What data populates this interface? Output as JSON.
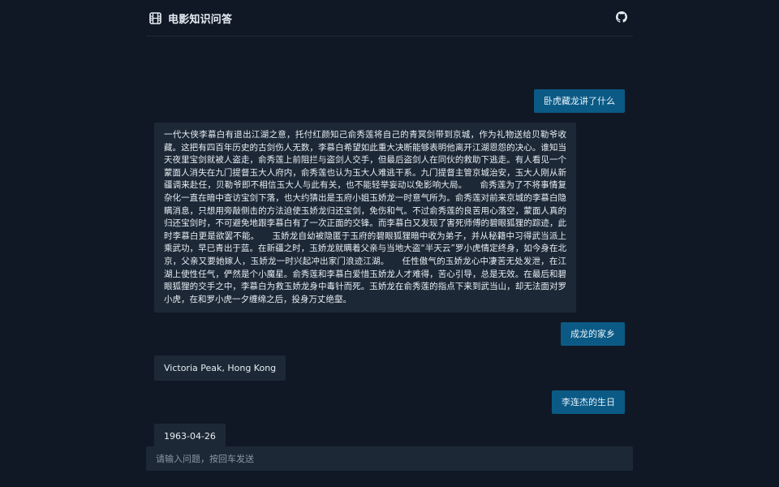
{
  "header": {
    "title": "电影知识问答",
    "logo_icon": "film-icon",
    "github_icon": "github-icon"
  },
  "colors": {
    "background": "#101826",
    "user_bubble": "#0b5a85",
    "bot_bubble": "#1d2836"
  },
  "messages": [
    {
      "role": "user",
      "text": "卧虎藏龙讲了什么"
    },
    {
      "role": "bot",
      "text": "一代大侠李慕白有退出江湖之意，托付红颜知己俞秀莲将自己的青冥剑带到京城，作为礼物送给贝勒爷收藏。这把有四百年历史的古剑伤人无数，李慕白希望如此重大决断能够表明他离开江湖恩怨的决心。谁知当天夜里宝剑就被人盗走，俞秀莲上前阻拦与盗剑人交手，但最后盗剑人在同伙的救助下逃走。有人看见一个蒙面人消失在九门提督玉大人府内，俞秀莲也认为玉大人难逃干系。九门提督主管京城治安，玉大人刚从新疆调来赴任，贝勒爷即不相信玉大人与此有关，也不能轻举妄动以免影响大局。　　俞秀莲为了不将事情复杂化一直在暗中查访宝剑下落，也大约猜出是玉府小姐玉娇龙一时意气所为。俞秀莲对前来京城的李慕白隐瞒消息，只想用旁敲侧击的方法迫使玉娇龙归还宝剑，免伤和气。不过俞秀莲的良苦用心落空，蒙面人真的归还宝剑时，不可避免地跟李慕白有了一次正面的交锋。而李慕白又发现了害死师傅的碧眼狐狸的踪迹，此时李慕白更是欲罢不能。　　玉娇龙自幼被隐匿于玉府的碧眼狐狸暗中收为弟子，并从秘籍中习得武当派上乘武功，早已青出于蓝。在新疆之时，玉娇龙就瞒着父亲与当地大盗“半天云”罗小虎情定终身，如今身在北京，父亲又要她嫁人，玉娇龙一时兴起冲出家门浪迹江湖。　　任性傲气的玉娇龙心中凄苦无处发泄，在江湖上使性任气，俨然是个小魔星。俞秀莲和李慕白爱惜玉娇龙人才难得，苦心引导，总是无效。在最后和碧眼狐狸的交手之中，李慕白为救玉娇龙身中毒针而死。玉娇龙在俞秀莲的指点下来到武当山，却无法面对罗小虎，在和罗小虎一夕缠绵之后，投身万丈绝壑。"
    },
    {
      "role": "user",
      "text": "成龙的家乡"
    },
    {
      "role": "bot",
      "text": "Victoria Peak, Hong Kong"
    },
    {
      "role": "user",
      "text": "李连杰的生日"
    },
    {
      "role": "bot",
      "text": "1963-04-26"
    }
  ],
  "input": {
    "placeholder": "请输入问题，按回车发送",
    "value": ""
  }
}
